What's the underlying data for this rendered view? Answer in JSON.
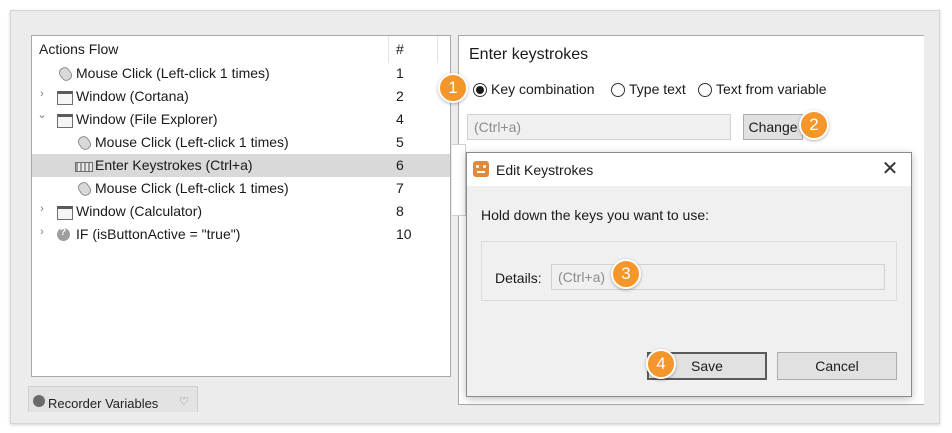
{
  "actions_flow": {
    "header_name": "Actions Flow",
    "header_num": "#",
    "rows": [
      {
        "label": "Mouse Click (Left-click 1 times)",
        "num": "1",
        "icon": "mouse-icon",
        "chevron": ""
      },
      {
        "label": "Window (Cortana)",
        "num": "2",
        "icon": "window-icon",
        "chevron": "›"
      },
      {
        "label": "Window (File Explorer)",
        "num": "4",
        "icon": "window-icon",
        "chevron": "⌄"
      },
      {
        "label": "Mouse Click (Left-click 1 times)",
        "num": "5",
        "icon": "mouse-icon",
        "chevron": ""
      },
      {
        "label": "Enter Keystrokes (Ctrl+a)",
        "num": "6",
        "icon": "keyboard-icon",
        "chevron": "",
        "selected": true
      },
      {
        "label": "Mouse Click (Left-click 1 times)",
        "num": "7",
        "icon": "mouse-icon",
        "chevron": ""
      },
      {
        "label": "Window (Calculator)",
        "num": "8",
        "icon": "window-icon",
        "chevron": "›"
      },
      {
        "label": "IF (isButtonActive = \"true\")",
        "num": "10",
        "icon": "if-condition-icon",
        "chevron": "›"
      }
    ]
  },
  "bottom_tab": {
    "label": "Recorder Variables",
    "chevron": "♡"
  },
  "keystrokes_panel": {
    "title": "Enter keystrokes",
    "radio_key_combination": "Key combination",
    "radio_type_text": "Type text",
    "radio_text_from_variable": "Text from variable",
    "selected_option": "Key combination",
    "input_value": "(Ctrl+a)",
    "change_button": "Change"
  },
  "dialog": {
    "title": "Edit Keystrokes",
    "close": "✕",
    "instruction": "Hold down the keys you want to use:",
    "details_label": "Details:",
    "details_value": "(Ctrl+a)",
    "save_button": "Save",
    "cancel_button": "Cancel"
  },
  "step_badges": [
    "1",
    "2",
    "3",
    "4"
  ],
  "colors": {
    "badge": "#f5962b",
    "selected_row": "#d9d9d9",
    "dialog_bg": "#f0f0f0"
  }
}
